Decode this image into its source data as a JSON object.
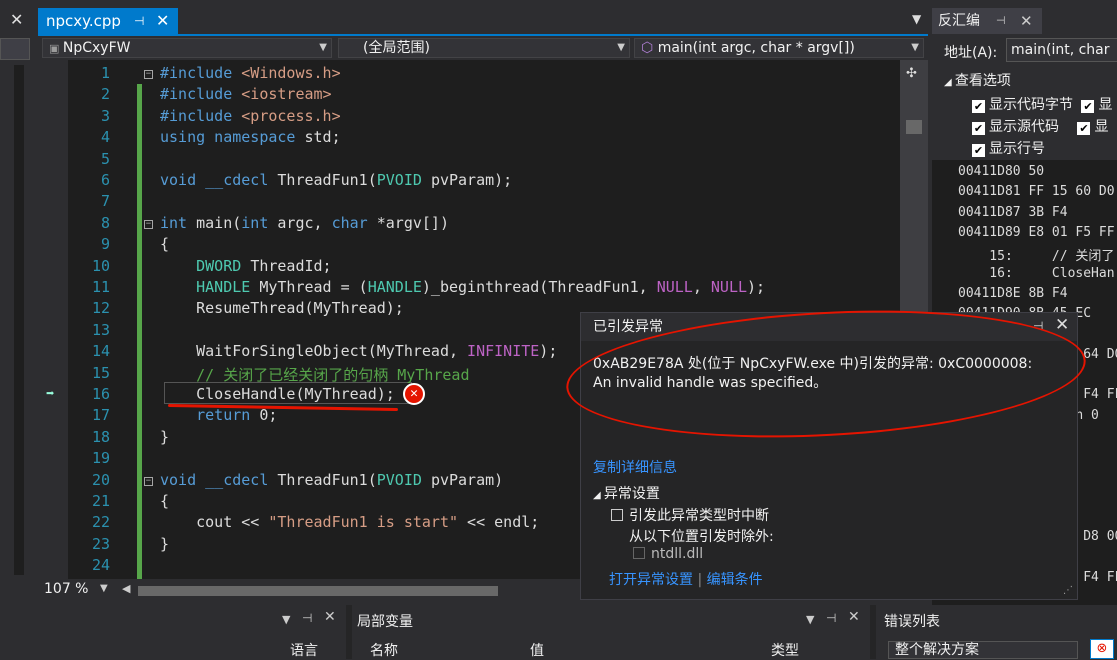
{
  "left_panel": {
    "close_glyph": "✕"
  },
  "tab": {
    "filename": "npcxy.cpp",
    "pin_glyph": "⊣",
    "close_glyph": "✕"
  },
  "nav": {
    "project": "NpCxyFW",
    "scope": "(全局范围)",
    "function": "main(int argc, char * argv[])"
  },
  "editor": {
    "line_numbers": [
      "1",
      "2",
      "3",
      "4",
      "5",
      "6",
      "7",
      "8",
      "9",
      "10",
      "11",
      "12",
      "13",
      "14",
      "15",
      "16",
      "17",
      "18",
      "19",
      "20",
      "21",
      "22",
      "23",
      "24"
    ],
    "lines": [
      [
        {
          "t": "#include ",
          "c": "kw"
        },
        {
          "t": "<Windows.h>",
          "c": "str"
        }
      ],
      [
        {
          "t": "#include ",
          "c": "kw"
        },
        {
          "t": "<iostream>",
          "c": "str"
        }
      ],
      [
        {
          "t": "#include ",
          "c": "kw"
        },
        {
          "t": "<process.h>",
          "c": "str"
        }
      ],
      [
        {
          "t": "using namespace ",
          "c": "kw"
        },
        {
          "t": "std;",
          "c": ""
        }
      ],
      [],
      [
        {
          "t": "void ",
          "c": "kw"
        },
        {
          "t": "__cdecl ",
          "c": "kw"
        },
        {
          "t": "ThreadFun1(",
          "c": ""
        },
        {
          "t": "PVOID ",
          "c": "typ"
        },
        {
          "t": "pvParam);",
          "c": ""
        }
      ],
      [],
      [
        {
          "t": "int ",
          "c": "kw"
        },
        {
          "t": "main(",
          "c": ""
        },
        {
          "t": "int ",
          "c": "kw"
        },
        {
          "t": "argc, ",
          "c": ""
        },
        {
          "t": "char ",
          "c": "kw"
        },
        {
          "t": "*argv[])",
          "c": ""
        }
      ],
      [
        {
          "t": "{",
          "c": ""
        }
      ],
      [
        {
          "t": "    DWORD ",
          "c": "typ"
        },
        {
          "t": "ThreadId;",
          "c": ""
        }
      ],
      [
        {
          "t": "    HANDLE ",
          "c": "typ"
        },
        {
          "t": "MyThread = (",
          "c": ""
        },
        {
          "t": "HANDLE",
          "c": "typ"
        },
        {
          "t": ")_beginthread(ThreadFun1, ",
          "c": ""
        },
        {
          "t": "NULL",
          "c": "mac"
        },
        {
          "t": ", ",
          "c": ""
        },
        {
          "t": "NULL",
          "c": "mac"
        },
        {
          "t": ");",
          "c": ""
        }
      ],
      [
        {
          "t": "    ResumeThread(MyThread);",
          "c": ""
        }
      ],
      [],
      [
        {
          "t": "    WaitForSingleObject(MyThread, ",
          "c": ""
        },
        {
          "t": "INFINITE",
          "c": "mac"
        },
        {
          "t": ");",
          "c": ""
        }
      ],
      [
        {
          "t": "    // 关闭了已经关闭了的句柄 MyThread",
          "c": "cmt"
        }
      ],
      [
        {
          "t": "    CloseHandle(MyThread);",
          "c": ""
        }
      ],
      [
        {
          "t": "    return ",
          "c": "kw"
        },
        {
          "t": "0;",
          "c": ""
        }
      ],
      [
        {
          "t": "}",
          "c": ""
        }
      ],
      [],
      [
        {
          "t": "void ",
          "c": "kw"
        },
        {
          "t": "__cdecl ",
          "c": "kw"
        },
        {
          "t": "ThreadFun1(",
          "c": ""
        },
        {
          "t": "PVOID ",
          "c": "typ"
        },
        {
          "t": "pvParam)",
          "c": ""
        }
      ],
      [
        {
          "t": "{",
          "c": ""
        }
      ],
      [
        {
          "t": "    cout << ",
          "c": ""
        },
        {
          "t": "\"ThreadFun1 is start\"",
          "c": "str"
        },
        {
          "t": " << endl;",
          "c": ""
        }
      ],
      [
        {
          "t": "}",
          "c": ""
        }
      ],
      []
    ],
    "zoom": "107 %",
    "error_glyph": "✕"
  },
  "disassembly": {
    "title": "反汇编",
    "address_label": "地址(A):",
    "address_value": "main(int, char",
    "view_options_label": "查看选项",
    "options": [
      {
        "label": "显示代码字节",
        "checked": true
      },
      {
        "label": "显示源代码",
        "checked": true
      },
      {
        "label": "显示行号",
        "checked": true
      }
    ],
    "lines": [
      "00411D80 50",
      "00411D81 FF 15 60 D0",
      "00411D87 3B F4",
      "00411D89 E8 01 F5 FF",
      "    15:     // 关闭了",
      "    16:     CloseHan",
      "00411D8E 8B F4",
      "00411D90 8B 45 EC",
      "",
      "                64 D0",
      "",
      "                F4 FF",
      "             urn 0",
      "",
      "",
      "",
      "",
      "",
      "                D8 00",
      "",
      "                F4 FF"
    ]
  },
  "exception": {
    "title": "已引发异常",
    "message_line1": "0xAB29E78A 处(位于 NpCxyFW.exe 中)引发的异常: 0xC0000008:",
    "message_line2": "An invalid handle was specified。",
    "copy_details": "复制详细信息",
    "settings_header": "异常设置",
    "break_option": "引发此异常类型时中断",
    "except_when": "从以下位置引发时除外:",
    "module": "ntdll.dll",
    "open_settings": "打开异常设置",
    "edit_conditions": "编辑条件"
  },
  "bottom": {
    "locals_title": "局部变量",
    "errors_title": "错误列表",
    "lang_col": "语言",
    "name_col": "名称",
    "value_col": "值",
    "type_col": "类型",
    "scope_dropdown": "整个解决方案"
  }
}
